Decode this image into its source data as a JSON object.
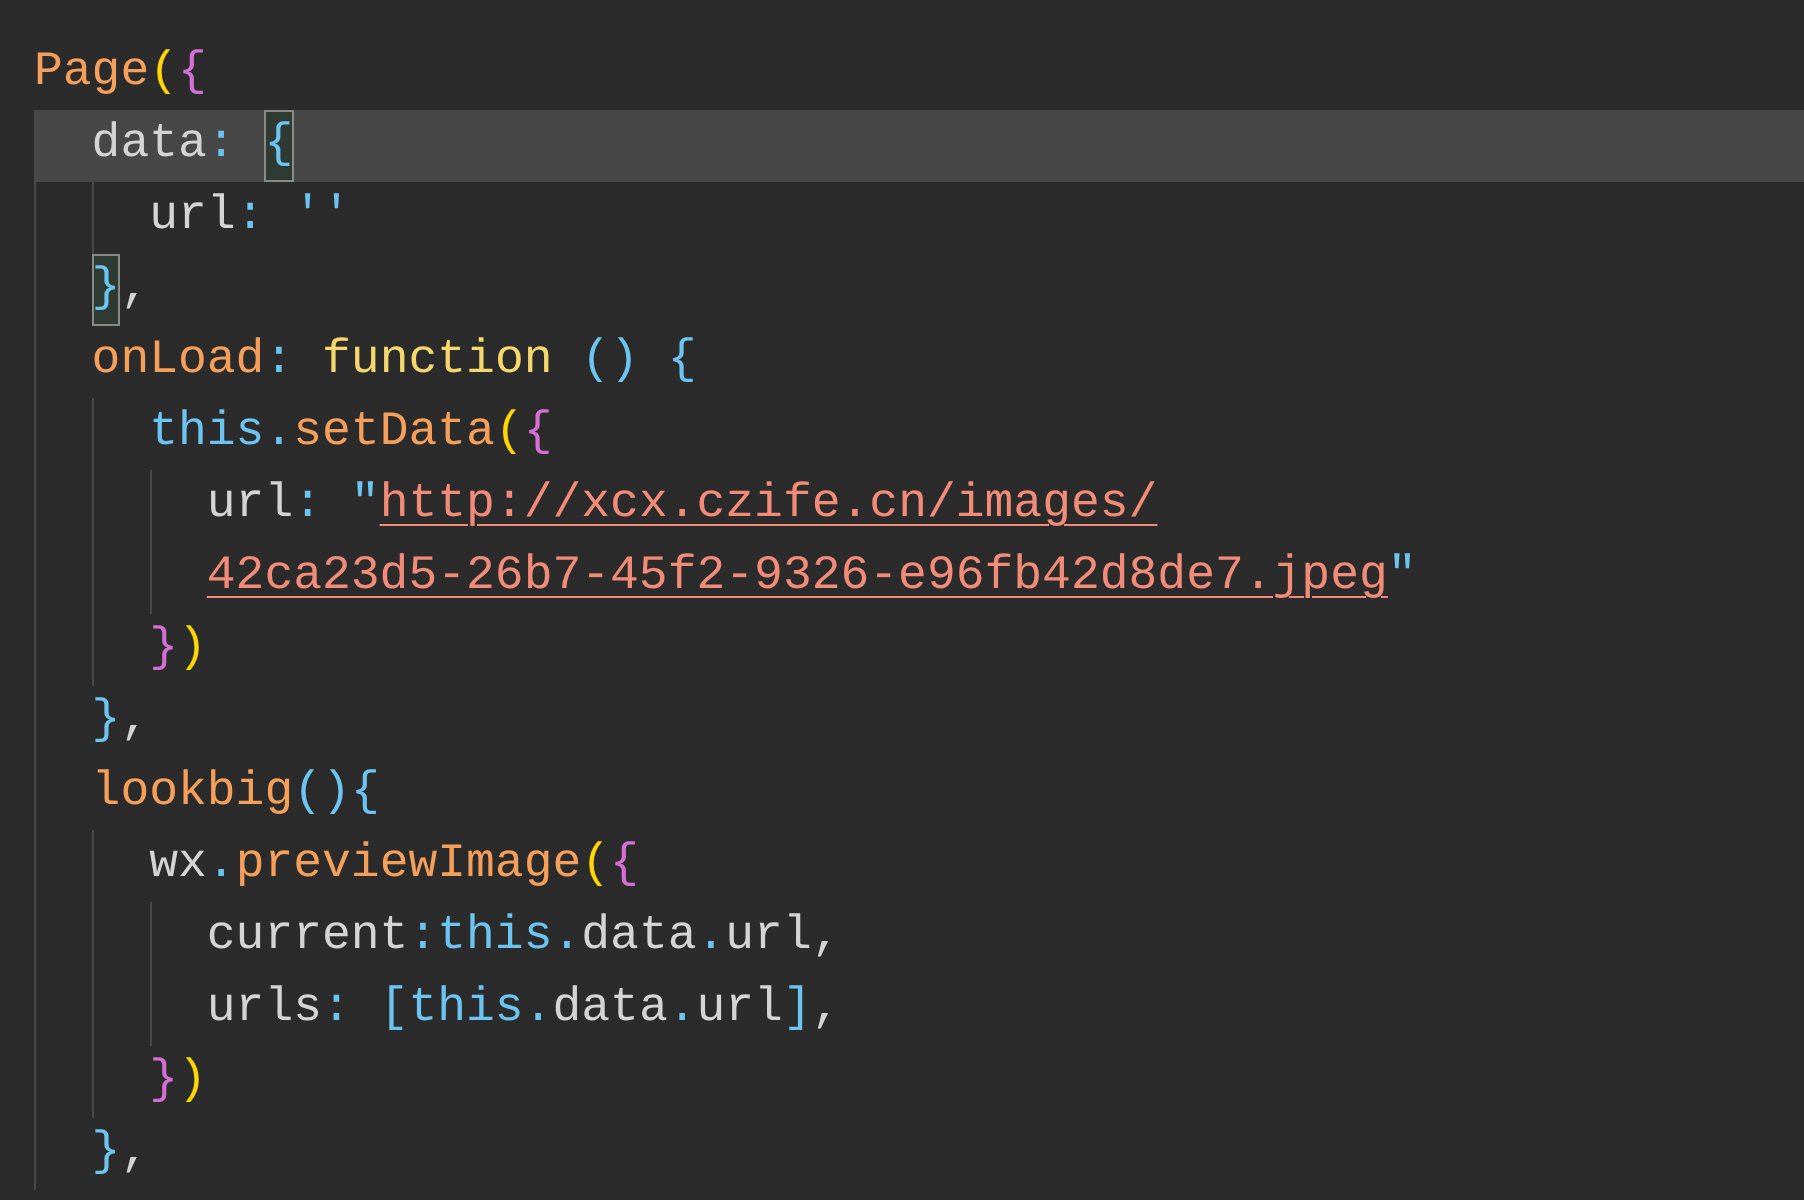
{
  "editor": {
    "lines": [
      {
        "current": false,
        "tokens": [
          {
            "text": "Page",
            "kind": "name"
          },
          {
            "text": "(",
            "kind": "b1"
          },
          {
            "text": "{",
            "kind": "b2"
          }
        ],
        "children": [
          {
            "current": true,
            "tokens": [
              {
                "text": "data",
                "kind": "plain"
              },
              {
                "text": ": ",
                "kind": "punct"
              },
              {
                "text": "{",
                "kind": "b3",
                "matched": true
              }
            ],
            "children": [
              {
                "current": false,
                "tokens": [
                  {
                    "text": "url",
                    "kind": "plain"
                  },
                  {
                    "text": ": ",
                    "kind": "punct"
                  },
                  {
                    "text": "''",
                    "kind": "quote"
                  }
                ]
              }
            ]
          },
          {
            "current": false,
            "tokens": [
              {
                "text": "}",
                "kind": "b3",
                "matched": true
              },
              {
                "text": ",",
                "kind": "plain"
              }
            ]
          },
          {
            "current": false,
            "tokens": [
              {
                "text": "onLoad",
                "kind": "name"
              },
              {
                "text": ": ",
                "kind": "punct"
              },
              {
                "text": "function ",
                "kind": "keyword"
              },
              {
                "text": "() ",
                "kind": "b3"
              },
              {
                "text": "{",
                "kind": "b3"
              }
            ],
            "children": [
              {
                "current": false,
                "tokens": [
                  {
                    "text": "this",
                    "kind": "this"
                  },
                  {
                    "text": ".",
                    "kind": "punct"
                  },
                  {
                    "text": "setData",
                    "kind": "name"
                  },
                  {
                    "text": "(",
                    "kind": "b1"
                  },
                  {
                    "text": "{",
                    "kind": "b2"
                  }
                ],
                "children": [
                  {
                    "current": false,
                    "tokens": [
                      {
                        "text": "url",
                        "kind": "plain"
                      },
                      {
                        "text": ": ",
                        "kind": "punct"
                      },
                      {
                        "text": "\"",
                        "kind": "quote"
                      },
                      {
                        "text": "http://xcx.czife.cn/images/",
                        "kind": "link"
                      }
                    ]
                  },
                  {
                    "current": false,
                    "tokens": [
                      {
                        "text": "42ca23d5-26b7-45f2-9326-e96fb42d8de7.jpeg",
                        "kind": "link"
                      },
                      {
                        "text": "\"",
                        "kind": "quote"
                      }
                    ]
                  }
                ]
              },
              {
                "current": false,
                "tokens": [
                  {
                    "text": "}",
                    "kind": "b2"
                  },
                  {
                    "text": ")",
                    "kind": "b1"
                  }
                ]
              }
            ]
          },
          {
            "current": false,
            "tokens": [
              {
                "text": "}",
                "kind": "b3"
              },
              {
                "text": ",",
                "kind": "plain"
              }
            ]
          },
          {
            "current": false,
            "tokens": [
              {
                "text": "lookbig",
                "kind": "name"
              },
              {
                "text": "()",
                "kind": "b3"
              },
              {
                "text": "{",
                "kind": "b3"
              }
            ],
            "children": [
              {
                "current": false,
                "tokens": [
                  {
                    "text": "wx",
                    "kind": "plain"
                  },
                  {
                    "text": ".",
                    "kind": "punct"
                  },
                  {
                    "text": "previewImage",
                    "kind": "name"
                  },
                  {
                    "text": "(",
                    "kind": "b1"
                  },
                  {
                    "text": "{",
                    "kind": "b2"
                  }
                ],
                "children": [
                  {
                    "current": false,
                    "tokens": [
                      {
                        "text": "current",
                        "kind": "plain"
                      },
                      {
                        "text": ":",
                        "kind": "punct"
                      },
                      {
                        "text": "this",
                        "kind": "this"
                      },
                      {
                        "text": ".",
                        "kind": "punct"
                      },
                      {
                        "text": "data",
                        "kind": "plain"
                      },
                      {
                        "text": ".",
                        "kind": "punct"
                      },
                      {
                        "text": "url",
                        "kind": "plain"
                      },
                      {
                        "text": ",",
                        "kind": "plain"
                      }
                    ]
                  },
                  {
                    "current": false,
                    "tokens": [
                      {
                        "text": "urls",
                        "kind": "plain"
                      },
                      {
                        "text": ": ",
                        "kind": "punct"
                      },
                      {
                        "text": "[",
                        "kind": "b3"
                      },
                      {
                        "text": "this",
                        "kind": "this"
                      },
                      {
                        "text": ".",
                        "kind": "punct"
                      },
                      {
                        "text": "data",
                        "kind": "plain"
                      },
                      {
                        "text": ".",
                        "kind": "punct"
                      },
                      {
                        "text": "url",
                        "kind": "plain"
                      },
                      {
                        "text": "]",
                        "kind": "b3"
                      },
                      {
                        "text": ",",
                        "kind": "plain"
                      }
                    ]
                  }
                ]
              },
              {
                "current": false,
                "tokens": [
                  {
                    "text": "}",
                    "kind": "b2"
                  },
                  {
                    "text": ")",
                    "kind": "b1"
                  }
                ]
              }
            ]
          },
          {
            "current": false,
            "tokens": [
              {
                "text": "}",
                "kind": "b3"
              },
              {
                "text": ",",
                "kind": "plain"
              }
            ]
          }
        ]
      }
    ]
  }
}
